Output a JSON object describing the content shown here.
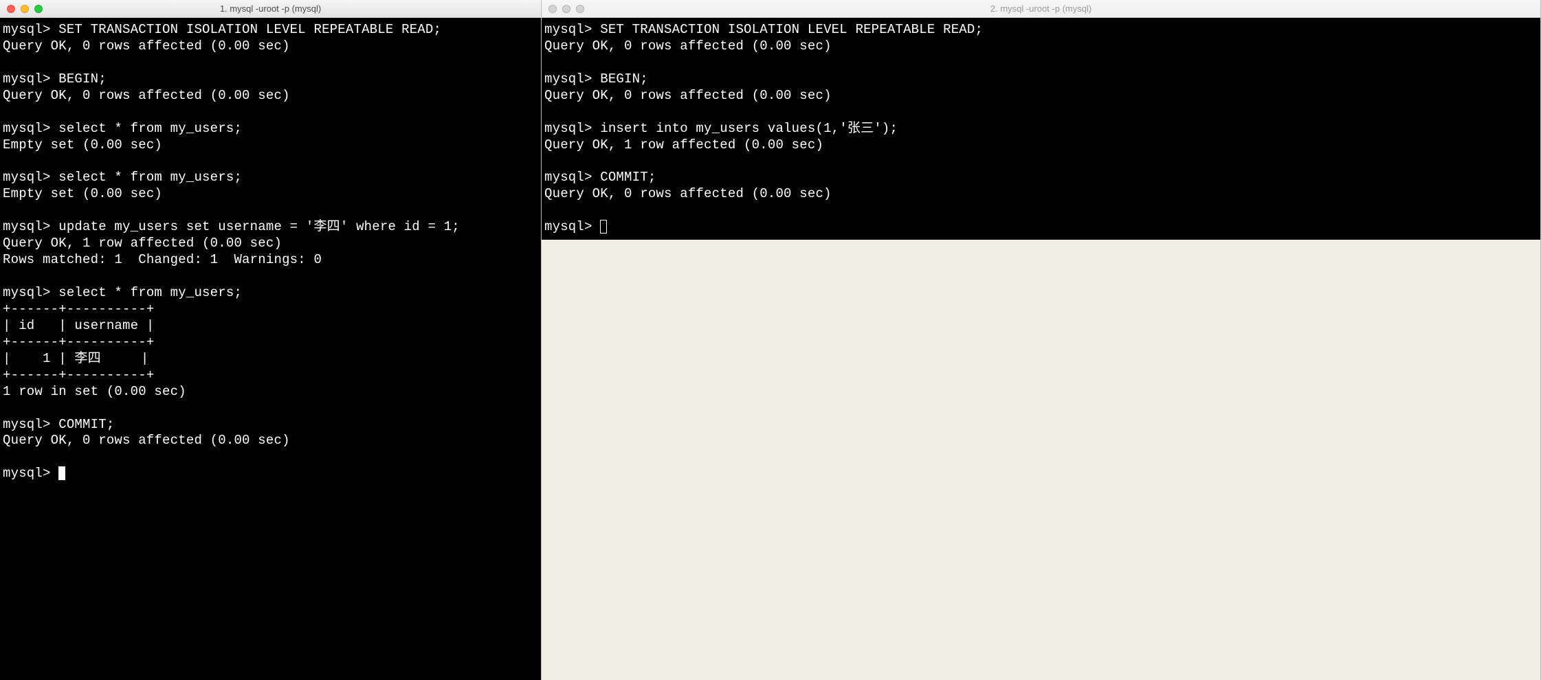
{
  "left": {
    "title": "1. mysql -uroot -p (mysql)",
    "lines": [
      "mysql> SET TRANSACTION ISOLATION LEVEL REPEATABLE READ;",
      "Query OK, 0 rows affected (0.00 sec)",
      "",
      "mysql> BEGIN;",
      "Query OK, 0 rows affected (0.00 sec)",
      "",
      "mysql> select * from my_users;",
      "Empty set (0.00 sec)",
      "",
      "mysql> select * from my_users;",
      "Empty set (0.00 sec)",
      "",
      "mysql> update my_users set username = '李四' where id = 1;",
      "Query OK, 1 row affected (0.00 sec)",
      "Rows matched: 1  Changed: 1  Warnings: 0",
      "",
      "mysql> select * from my_users;",
      "+------+----------+",
      "| id   | username |",
      "+------+----------+",
      "|    1 | 李四     |",
      "+------+----------+",
      "1 row in set (0.00 sec)",
      "",
      "mysql> COMMIT;",
      "Query OK, 0 rows affected (0.00 sec)",
      ""
    ],
    "prompt": "mysql> "
  },
  "right": {
    "title": "2. mysql -uroot -p (mysql)",
    "lines": [
      "mysql> SET TRANSACTION ISOLATION LEVEL REPEATABLE READ;",
      "Query OK, 0 rows affected (0.00 sec)",
      "",
      "mysql> BEGIN;",
      "Query OK, 0 rows affected (0.00 sec)",
      "",
      "mysql> insert into my_users values(1,'张三');",
      "Query OK, 1 row affected (0.00 sec)",
      "",
      "mysql> COMMIT;",
      "Query OK, 0 rows affected (0.00 sec)",
      ""
    ],
    "prompt": "mysql> "
  }
}
